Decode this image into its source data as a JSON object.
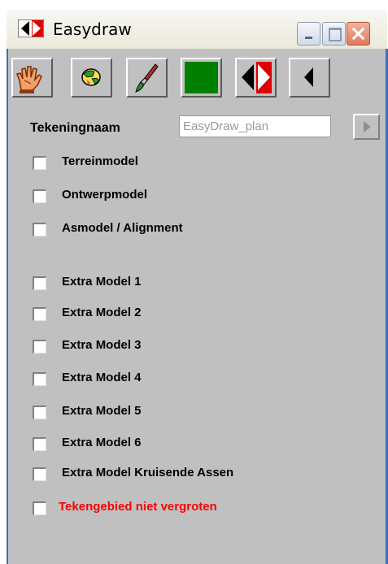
{
  "window": {
    "title": "Easydraw"
  },
  "toolbar": {
    "buttons": [
      {
        "name": "hand-tool-icon"
      },
      {
        "name": "globe-tool-icon"
      },
      {
        "name": "brush-tool-icon"
      },
      {
        "name": "green-color-swatch",
        "color": "#008000"
      },
      {
        "name": "toggle-left-right-icon"
      },
      {
        "name": "collapse-arrow-icon"
      }
    ],
    "swatch_color": "#008000"
  },
  "drawing": {
    "label": "Tekeningnaam",
    "name_value": "EasyDraw_plan"
  },
  "models": [
    {
      "label": "Terreinmodel",
      "checked": false
    },
    {
      "label": "Ontwerpmodel",
      "checked": false
    },
    {
      "label": "Asmodel / Alignment",
      "checked": false
    },
    {
      "label": "Extra Model 1",
      "checked": false
    },
    {
      "label": "Extra Model 2",
      "checked": false
    },
    {
      "label": "Extra Model 3",
      "checked": false
    },
    {
      "label": "Extra Model 4",
      "checked": false
    },
    {
      "label": "Extra Model 5",
      "checked": false
    },
    {
      "label": "Extra Model 6",
      "checked": false
    },
    {
      "label": "Extra Model Kruisende Assen",
      "checked": false
    }
  ],
  "options": {
    "no_enlarge_label": "Tekengebied niet vergroten",
    "no_enlarge_checked": false,
    "warning_color": "#ff0000"
  },
  "colors": {
    "panel_bg": "#c0c0c0",
    "window_border": "#3a6fc4"
  }
}
